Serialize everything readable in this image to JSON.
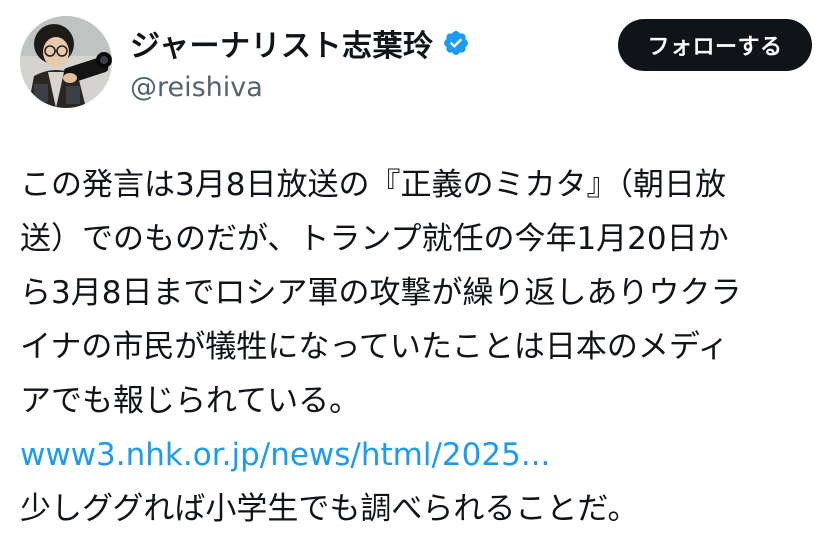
{
  "header": {
    "display_name": "ジャーナリスト志葉玲",
    "handle": "@reishiva",
    "follow_label": "フォローする",
    "verified_color": "#1d9bf0",
    "avatar_icon": "user-photo-avatar"
  },
  "body": {
    "lines": [
      "この発言は3月8日放送の『正義のミカタ』（朝日放",
      "送）でのものだが、トランプ就任の今年1月20日か",
      "ら3月8日までロシア軍の攻撃が繰り返しありウクラ",
      "イナの市民が犠牲になっていたことは日本のメディ",
      "アでも報じられている。"
    ],
    "link_text": "www3.nhk.or.jp/news/html/2025...",
    "closing_line": "少しググれば小学生でも調べられることだ。",
    "link_color": "#1d9bf0"
  }
}
